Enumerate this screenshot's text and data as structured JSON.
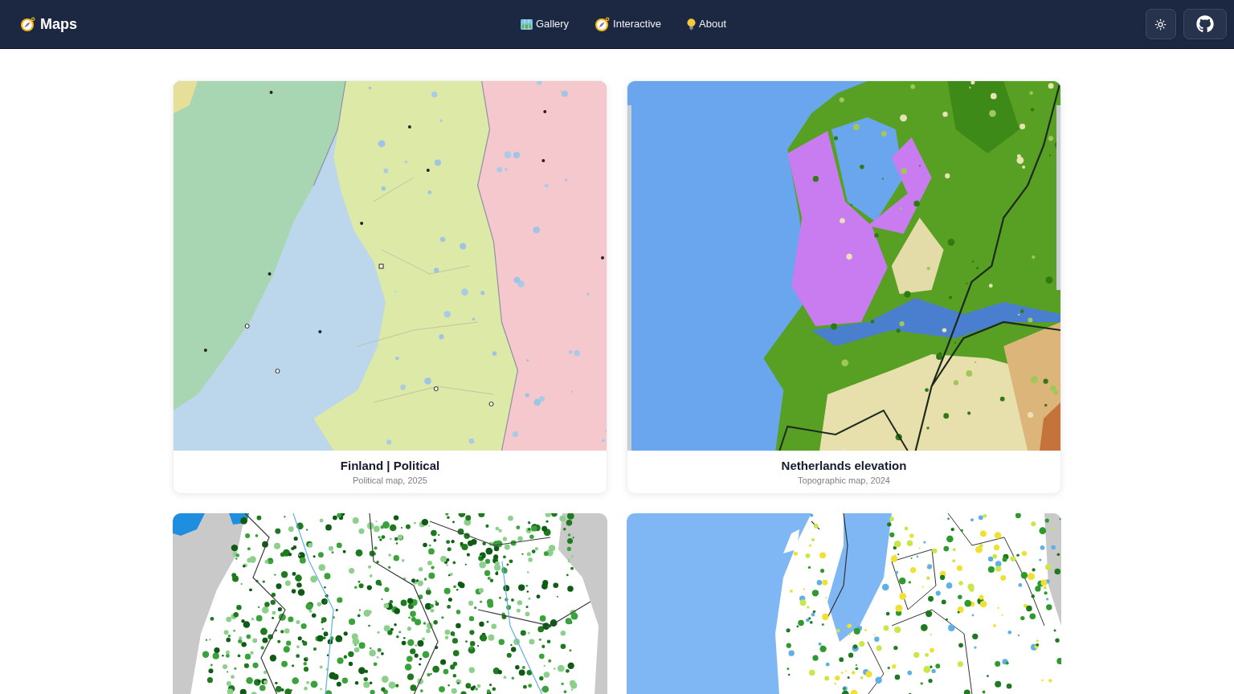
{
  "header": {
    "logo": "Maps",
    "nav": [
      {
        "label": "Gallery"
      },
      {
        "label": "Interactive"
      },
      {
        "label": "About"
      }
    ]
  },
  "gallery": {
    "cards": [
      {
        "kind": "political",
        "title": "Finland | Political",
        "subtitle": "Political map, 2025"
      },
      {
        "kind": "elevation",
        "title": "Netherlands elevation",
        "subtitle": "Topographic map, 2024"
      },
      {
        "kind": "vegetation"
      },
      {
        "kind": "landcover"
      }
    ]
  }
}
